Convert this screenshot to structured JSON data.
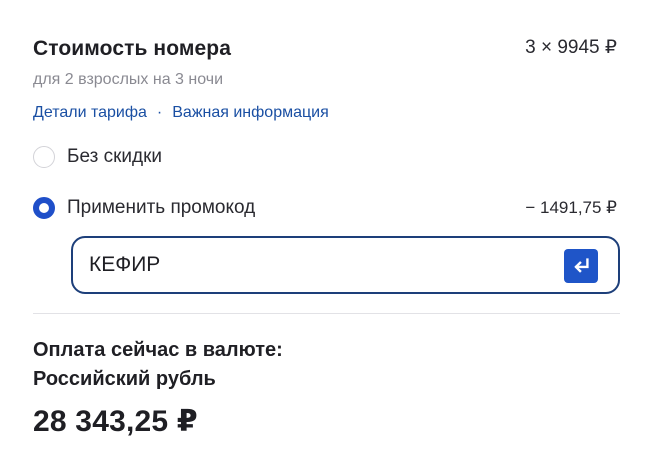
{
  "room_cost": {
    "title": "Стоимость номера",
    "price": "3 × 9945 ₽",
    "subtitle": "для 2 взрослых на 3 ночи"
  },
  "links": {
    "tariff_details": "Детали тарифа",
    "separator": "·",
    "important_info": "Важная информация"
  },
  "options": {
    "no_discount_label": "Без скидки",
    "no_discount_selected": false,
    "promo_label": "Применить промокод",
    "promo_selected": true,
    "promo_discount": "− 1491,75 ₽"
  },
  "promo_field": {
    "value": "КЕФИР",
    "enter_icon": "enter-return-icon"
  },
  "payment": {
    "label_line1": "Оплата сейчас в валюте:",
    "label_line2": "Российский рубль",
    "total": "28 343,25 ₽"
  },
  "colors": {
    "accent": "#1f55c8",
    "link": "#1a4fa3",
    "field_border": "#1d3f7a"
  }
}
